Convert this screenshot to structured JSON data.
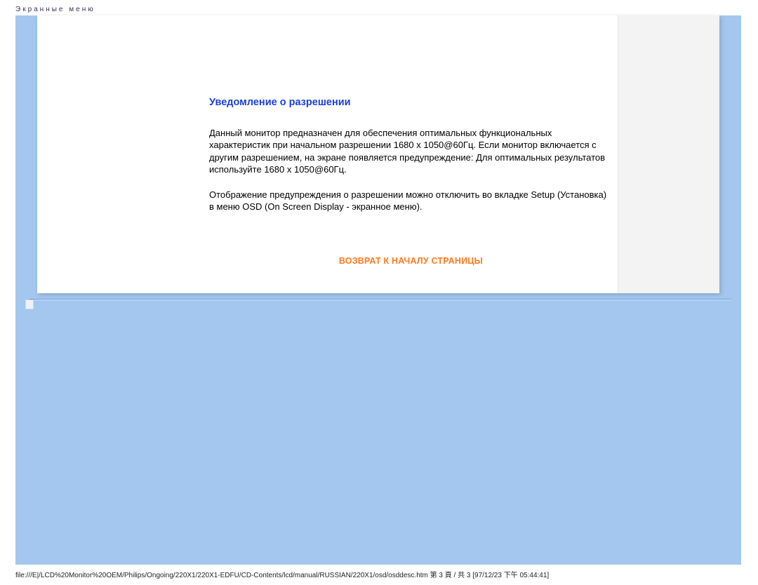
{
  "header": {
    "title": "Экранные меню"
  },
  "section": {
    "heading": "Уведомление о разрешении",
    "para1": "Данный монитор предназначен для обеспечения оптимальных функциональных характеристик при начальном разрешении 1680 x 1050@60Гц. Если монитор включается с другим разрешением, на экране появляется предупреждение: Для оптимальных результатов используйте 1680 x 1050@60Гц.",
    "para2": "Отображение предупреждения о разрешении можно отключить во вкладке Setup (Установка) в меню OSD (On Screen Display - экранное меню).",
    "back_link": "ВОЗВРАТ К НАЧАЛУ СТРАНИЦЫ"
  },
  "footer": {
    "path": "file:///E|/LCD%20Monitor%20OEM/Philips/Ongoing/220X1/220X1-EDFU/CD-Contents/lcd/manual/RUSSIAN/220X1/osd/osddesc.htm 第 3 頁 / 共 3  [97/12/23 下午 05:44:41]"
  }
}
